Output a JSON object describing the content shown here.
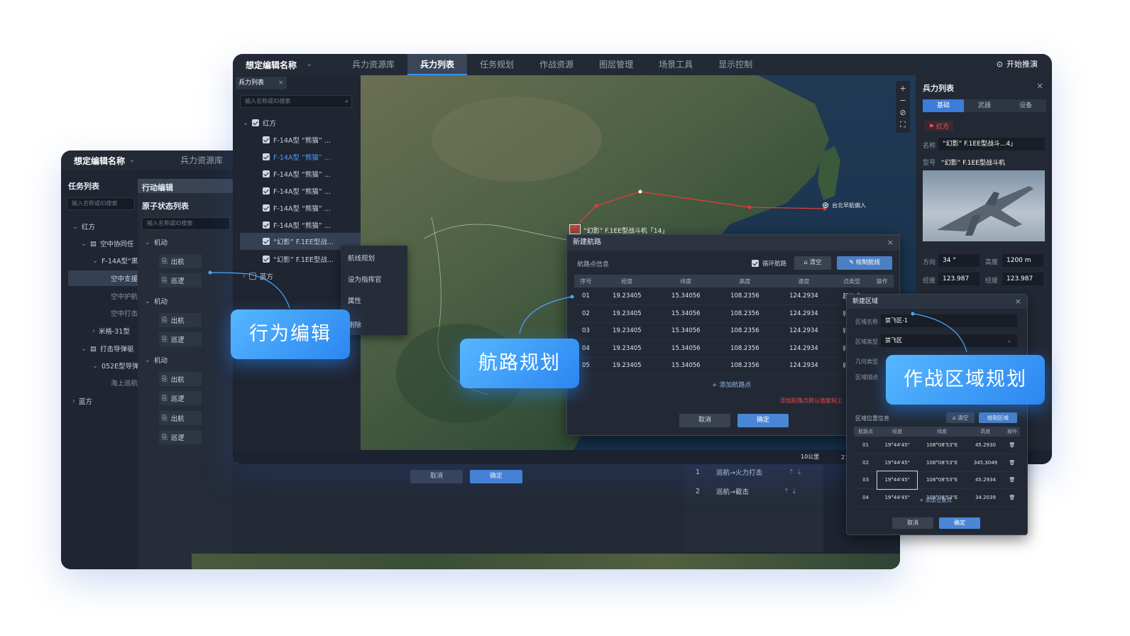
{
  "back_window": {
    "title": "想定编辑名称",
    "tab": "兵力资源库",
    "left_panel": {
      "title": "任务列表",
      "search_placeholder": "输入名称或ID搜索",
      "tree": [
        "红方",
        "空中协同任",
        "F-14A型“黑",
        "空中支援",
        "空中护航",
        "空中打击",
        "米格-31型",
        "打击导弹驱",
        "052E型导弹",
        "海上巡航",
        "蓝方"
      ]
    },
    "action_panel": {
      "title": "行动编辑",
      "subtitle": "原子状态列表",
      "search_placeholder": "输入名称或ID搜索",
      "groups": [
        {
          "label": "机动",
          "items": [
            "出航",
            "巡逻"
          ]
        },
        {
          "label": "机动",
          "items": [
            "出航",
            "巡逻"
          ]
        },
        {
          "label": "机动",
          "items": [
            "出航",
            "巡逻",
            "出航",
            "巡逻"
          ]
        }
      ]
    },
    "bottom_buttons": {
      "cancel": "取消",
      "confirm": "确定"
    },
    "sequence": [
      {
        "no": "1",
        "text": "巡航→火力打击"
      },
      {
        "no": "2",
        "text": "巡航→截击"
      }
    ]
  },
  "main_window": {
    "title": "想定编辑名称",
    "tabs": [
      "兵力资源库",
      "兵力列表",
      "任务规划",
      "作战资源",
      "图层管理",
      "场景工具",
      "显示控制"
    ],
    "active_tab": "兵力列表",
    "start_button": "开始推演",
    "force_panel": {
      "title": "兵力列表",
      "search_placeholder": "输入名称或ID搜索",
      "red": "红方",
      "items": [
        "F-14A型 “熊猫” ...",
        "F-14A型 “熊猫” ...",
        "F-14A型 “熊猫” ...",
        "F-14A型 “熊猫” ...",
        "F-14A型 “熊猫” ...",
        "F-14A型 “熊猫” ...",
        "“幻影” F.1EE型战...",
        "“幻影” F.1EE型战..."
      ],
      "blue": "蓝方"
    },
    "context_menu": [
      "航线规划",
      "设为指挥官",
      "属性",
      "删除"
    ],
    "map_label": "“幻影” F.1EE型战斗机「14」",
    "map_label_2": "台北早航偏入",
    "scale": "10公里",
    "coord": "27°31'",
    "route_dialog": {
      "title": "新建航路",
      "section": "航路点信息",
      "loop_label": "循环航路",
      "clear_button": "清空",
      "draw_button": "绘制航线",
      "columns": [
        "序号",
        "经度",
        "纬度",
        "高度",
        "速度",
        "点类型",
        "操作"
      ],
      "rows": [
        {
          "no": "01",
          "lng": "19.23405",
          "lat": "15.34056",
          "alt": "108.2356",
          "spd": "124.2934",
          "type": "起始点"
        },
        {
          "no": "02",
          "lng": "19.23405",
          "lat": "15.34056",
          "alt": "108.2356",
          "spd": "124.2934",
          "type": "转弯点"
        },
        {
          "no": "03",
          "lng": "19.23405",
          "lat": "15.34056",
          "alt": "108.2356",
          "spd": "124.2934",
          "type": "转弯点"
        },
        {
          "no": "04",
          "lng": "19.23405",
          "lat": "15.34056",
          "alt": "108.2356",
          "spd": "124.2934",
          "type": "转弯点"
        },
        {
          "no": "05",
          "lng": "19.23405",
          "lat": "15.34056",
          "alt": "108.2356",
          "spd": "124.2934",
          "type": "转弯点"
        }
      ],
      "add_point": "添加航路点",
      "warning": "添加航路点默认值复制上",
      "cancel": "取消",
      "confirm": "确定"
    },
    "detail_panel": {
      "title": "兵力列表",
      "tabs": [
        "基础",
        "武器",
        "设备"
      ],
      "side": "红方",
      "name_label": "名称",
      "name_value": "“幻影” F.1EE型战斗...4」",
      "model_label": "型号",
      "model_value": "“幻影” F.1EE型战斗机",
      "heading_label": "方向",
      "heading_value": "34 °",
      "altitude_label": "高度",
      "altitude_value": "1200 m",
      "lng_label": "经度",
      "lng_value": "123.987",
      "lat_label": "经度",
      "lat_value": "123.987"
    }
  },
  "zone_dialog": {
    "title": "新建区域",
    "name_label": "区域名称",
    "name_value": "禁飞区-1",
    "type_label": "区域类型",
    "type_value": "禁飞区",
    "shape_label": "几何类型",
    "desc_label": "区域描述",
    "section": "区域位置信息",
    "clear_button": "清空",
    "draw_button": "绘制区域",
    "columns": [
      "航路点",
      "经度",
      "纬度",
      "高度",
      "操作"
    ],
    "rows": [
      {
        "no": "01",
        "lng": "19°44'45\"",
        "lat": "108°08'53\"E",
        "alt": "45.2930"
      },
      {
        "no": "02",
        "lng": "19°44'45\"",
        "lat": "108°08'53\"E",
        "alt": "345.3049"
      },
      {
        "no": "03",
        "lng": "19°44'45\"",
        "lat": "108°08'53\"E",
        "alt": "45.2934"
      },
      {
        "no": "04",
        "lng": "19°44'45\"",
        "lat": "108°08'53\"E",
        "alt": "34.2039"
      }
    ],
    "add_point": "添加位置点",
    "cancel": "取消",
    "confirm": "确定"
  },
  "callouts": {
    "behavior": "行为编辑",
    "route": "航路规划",
    "zone": "作战区域规划"
  },
  "colors": {
    "accent": "#3b7dd8",
    "route_line": "#e53b3b",
    "callout": "#3f9cf6"
  }
}
